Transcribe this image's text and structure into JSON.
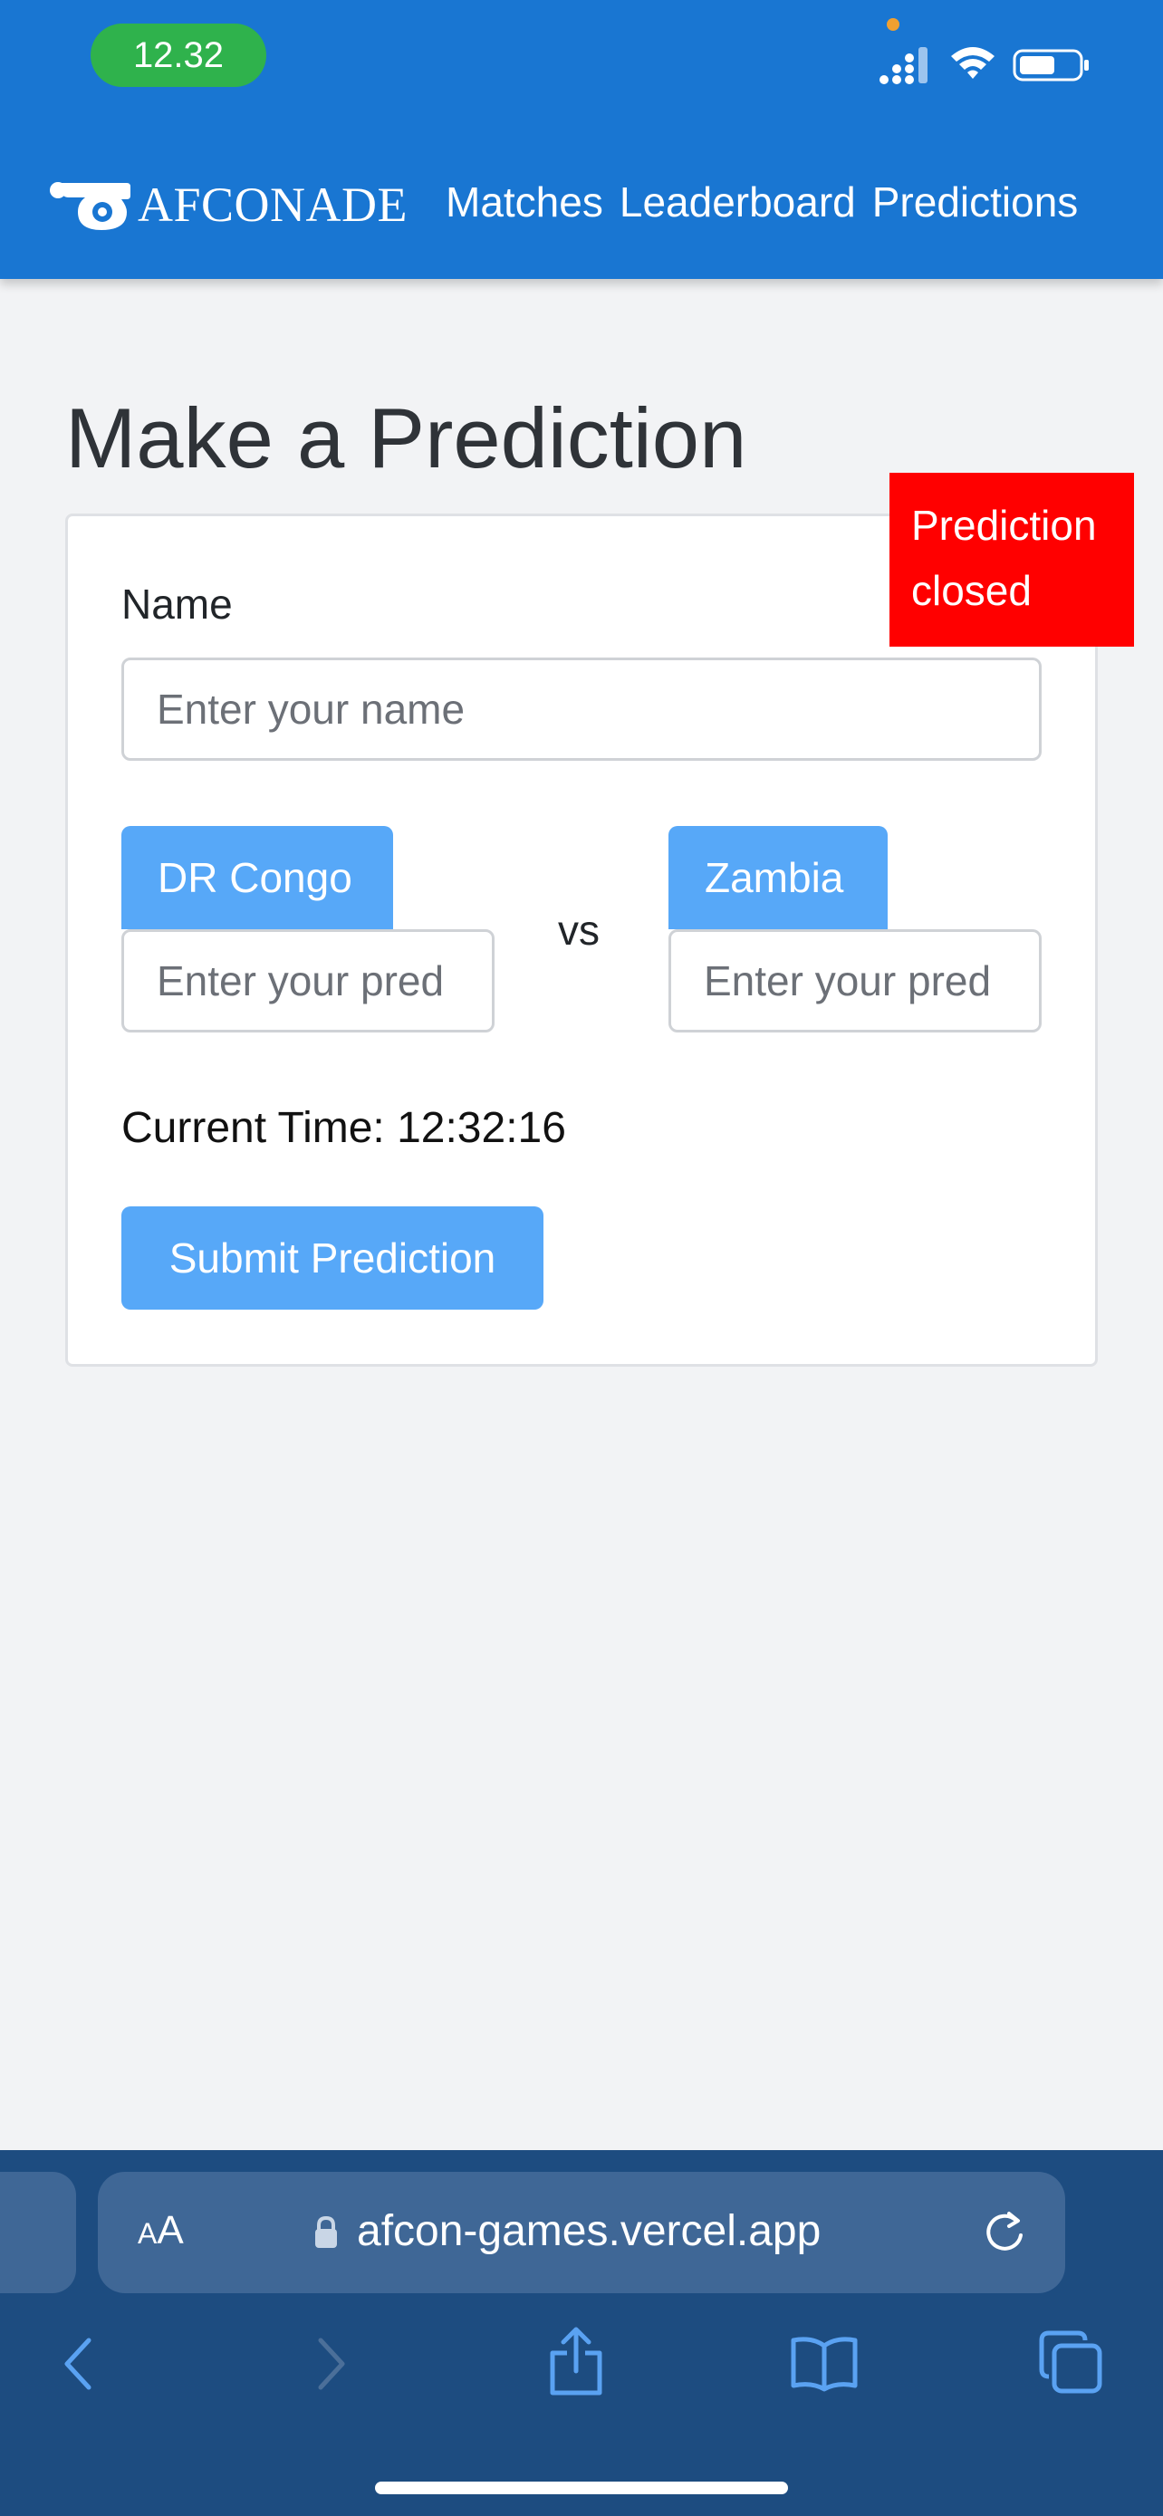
{
  "status_bar": {
    "time": "12.32"
  },
  "header": {
    "brand": "AFCONADE",
    "nav": [
      {
        "label": "Matches"
      },
      {
        "label": "Leaderboard"
      },
      {
        "label": "Predictions"
      }
    ]
  },
  "page": {
    "title": "Make a Prediction",
    "closed_badge": "Prediction closed",
    "name_label": "Name",
    "name_placeholder": "Enter your name",
    "team_a": "DR Congo",
    "team_b": "Zambia",
    "vs": "vs",
    "prediction_placeholder": "Enter your pred",
    "current_time": "Current Time: 12:32:16",
    "submit_label": "Submit Prediction"
  },
  "browser": {
    "aa_label_small": "A",
    "aa_label_large": "A",
    "url": "afcon-games.vercel.app"
  },
  "colors": {
    "header_blue": "#1976d2",
    "button_blue": "#57a8f8",
    "closed_red": "#ff0000",
    "status_green": "#2fb24c",
    "safari_bar": "#1d4c80"
  },
  "icons": {
    "brand": "whistle-icon",
    "status": [
      "signal-icon",
      "wifi-icon",
      "battery-icon"
    ],
    "toolbar": [
      "back-icon",
      "forward-icon",
      "share-icon",
      "bookmarks-icon",
      "tabs-icon"
    ]
  }
}
